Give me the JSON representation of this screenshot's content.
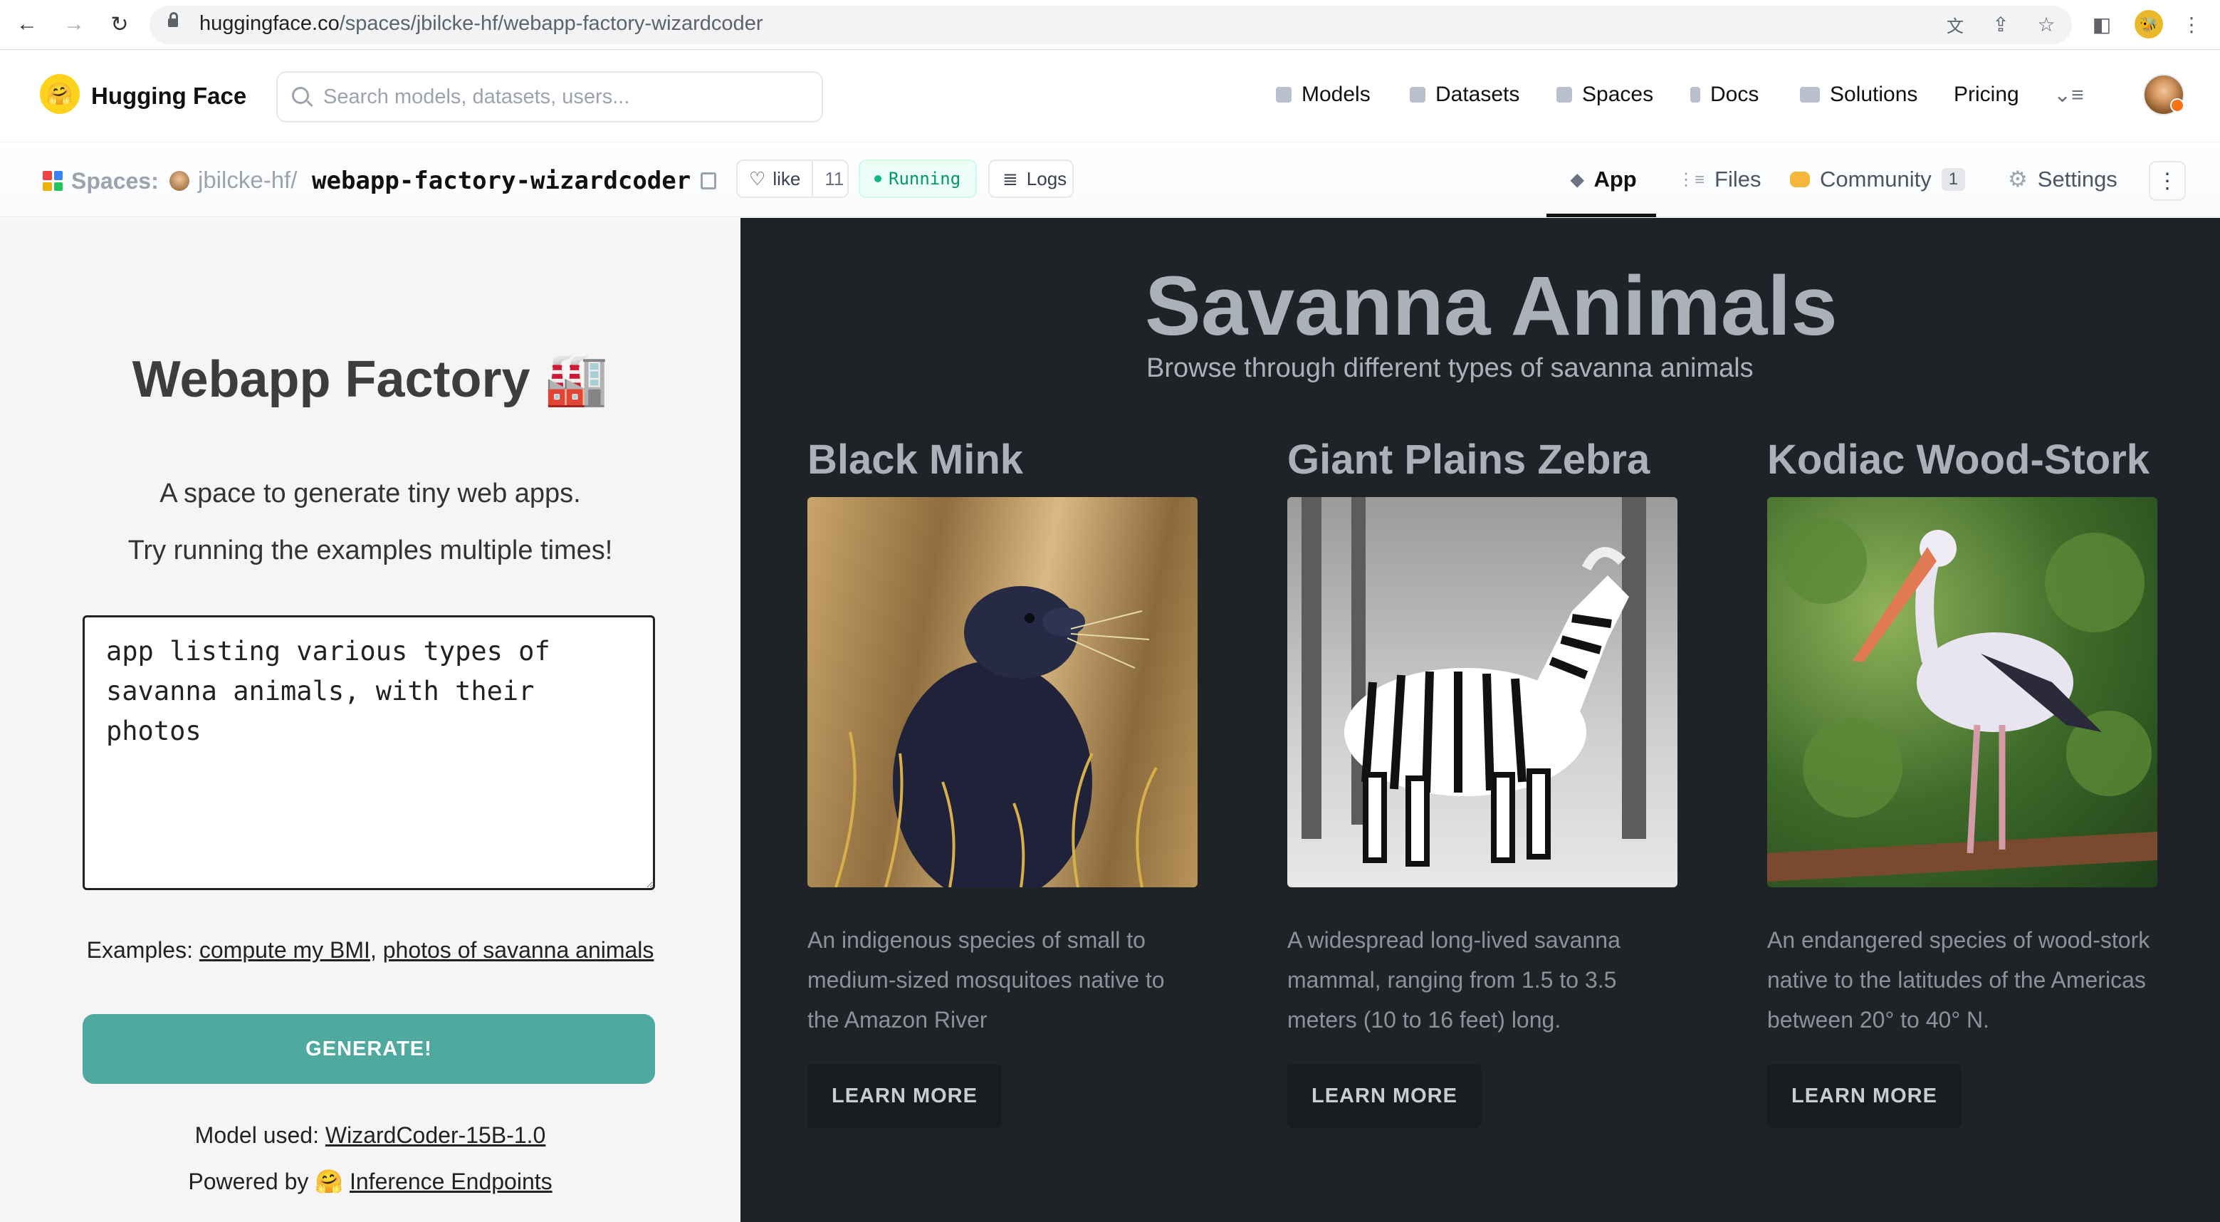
{
  "browser": {
    "url_domain": "huggingface.co",
    "url_path": "/spaces/jbilcke-hf/webapp-factory-wizardcoder"
  },
  "hf_nav": {
    "brand": "Hugging Face",
    "search_placeholder": "Search models, datasets, users...",
    "links": [
      "Models",
      "Datasets",
      "Spaces",
      "Docs",
      "Solutions",
      "Pricing"
    ]
  },
  "space_header": {
    "label": "Spaces:",
    "owner": "jbilcke-hf",
    "separator": "/",
    "repo": "webapp-factory-wizardcoder",
    "like_label": "like",
    "like_count": "11",
    "status": "Running",
    "logs_label": "Logs",
    "tabs": {
      "app": "App",
      "files": "Files",
      "community": "Community",
      "community_count": "1",
      "settings": "Settings"
    }
  },
  "left": {
    "title": "Webapp Factory 🏭",
    "tagline1": "A space to generate tiny web apps.",
    "tagline2": "Try running the examples multiple times!",
    "prompt_value": "app listing various types of savanna animals, with their photos",
    "examples_label": "Examples:",
    "example1": "compute my BMI",
    "example2": "photos of savanna animals",
    "generate_label": "GENERATE!",
    "model_label": "Model used:",
    "model_link": "WizardCoder-15B-1.0",
    "powered_label": "Powered by 🤗",
    "powered_link": "Inference Endpoints"
  },
  "right": {
    "title": "Savanna Animals",
    "subtitle": "Browse through different types of savanna animals",
    "cards": [
      {
        "name": "Black Mink",
        "description": "An indigenous species of small to medium-sized mosquitoes native to the Amazon River",
        "button": "LEARN MORE"
      },
      {
        "name": "Giant Plains Zebra",
        "description": "A widespread long-lived savanna mammal, ranging from 1.5 to 3.5 meters (10 to 16 feet) long.",
        "button": "LEARN MORE"
      },
      {
        "name": "Kodiac Wood-Stork",
        "description": "An endangered species of wood-stork native to the latitudes of the Americas between 20° to 40° N.",
        "button": "LEARN MORE"
      }
    ]
  },
  "colors": {
    "generate_button": "#4fa99e",
    "dark_panel": "#1f2328",
    "running_green": "#059669"
  }
}
